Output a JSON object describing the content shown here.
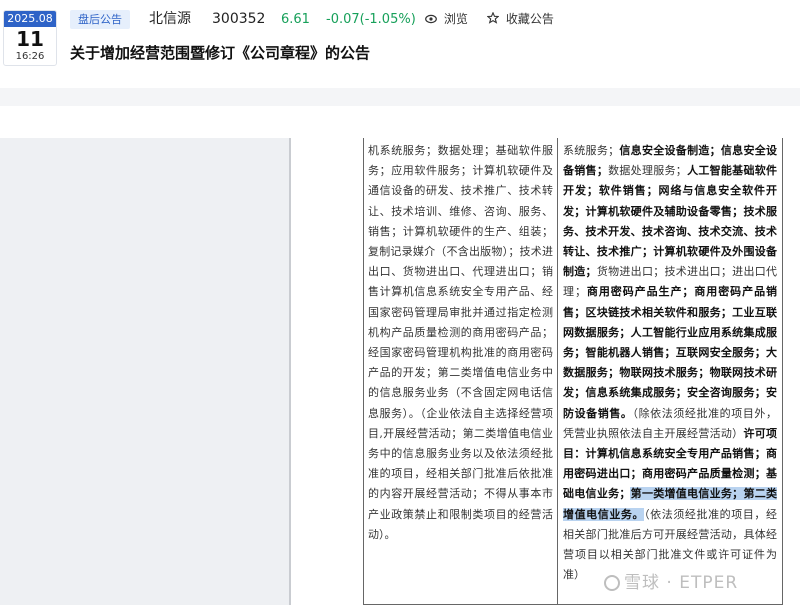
{
  "header": {
    "date": {
      "year_month": "2025.08",
      "day": "11",
      "time": "16:26"
    },
    "tag": "盘后公告",
    "stock_name": "北信源",
    "stock_code": "300352",
    "price": "6.61",
    "change": "-0.07(-1.05%)",
    "change_color": "#17a05a",
    "actions": [
      {
        "icon": "eye-icon",
        "label": "浏览"
      },
      {
        "icon": "star-icon",
        "label": "收藏公告"
      }
    ],
    "title": "关于增加经营范围暨修订《公司章程》的公告"
  },
  "table": {
    "left_text": "机系统服务；数据处理；基础软件服务；应用软件服务；计算机软硬件及通信设备的研发、技术推广、技术转让、技术培训、维修、咨询、服务、销售；计算机软硬件的生产、组装；复制记录媒介（不含出版物）；技术进出口、货物进出口、代理进出口；销售计算机信息系统安全专用产品、经国家密码管理局审批并通过指定检测机构产品质量检测的商用密码产品；经国家密码管理机构批准的商用密码产品的开发；第二类增值电信业务中的信息服务业务（不含固定网电话信息服务）。（企业依法自主选择经营项目,开展经营活动；第二类增值电信业务中的信息服务业务以及依法须经批准的项目，经相关部门批准后依批准的内容开展经营活动；不得从事本市产业政策禁止和限制类项目的经营活动）。",
    "right_segments": [
      {
        "text": "系统服务；",
        "bold": false
      },
      {
        "text": "信息安全设备制造；信息安全设备销售；",
        "bold": true
      },
      {
        "text": "数据处理服务；",
        "bold": false
      },
      {
        "text": "人工智能基础软件开发；软件销售；网络与信息安全软件开发；计算机软硬件及辅助设备零售；",
        "bold": true
      },
      {
        "text": "技术服务、技术开发、技术咨询、技术交流、技术转让、技术推广；计算机软硬件及外围设备制造；",
        "bold": true
      },
      {
        "text": "货物进出口；技术进出口；进出口代理；",
        "bold": false
      },
      {
        "text": "商用密码产品生产；商用密码产品销售；区块链技术相关软件和服务；工业互联网数据服务；人工智能行业应用系统集成服务；智能机器人销售；互联网安全服务；大数据服务；物联网技术服务；物联网技术研发；信息系统集成服务；安全咨询服务；安防设备销售。",
        "bold": true
      },
      {
        "text": "（除依法须经批准的项目外，凭营业执照依法自主开展经营活动）",
        "bold": false
      },
      {
        "text": "许可项目：计算机信息系统安全专用产品销售；商用密码进出口；商用密码产品质量检测；基础电信业务；",
        "bold": true
      },
      {
        "text": "第一类增值电信业务；第二类增值电信业务。",
        "bold": true,
        "highlight": true
      },
      {
        "text": "（依法须经批准的项目，经相关部门批准后方可开展经营活动，具体经营项目以相关部门批准文件或许可证件为准）",
        "bold": false
      }
    ]
  },
  "watermark": "雪球 · ETPER",
  "colors": {
    "accent": "#2e63c7",
    "tag_bg": "#e6effc",
    "down_green": "#17a05a",
    "highlight": "#b9d3f0"
  }
}
